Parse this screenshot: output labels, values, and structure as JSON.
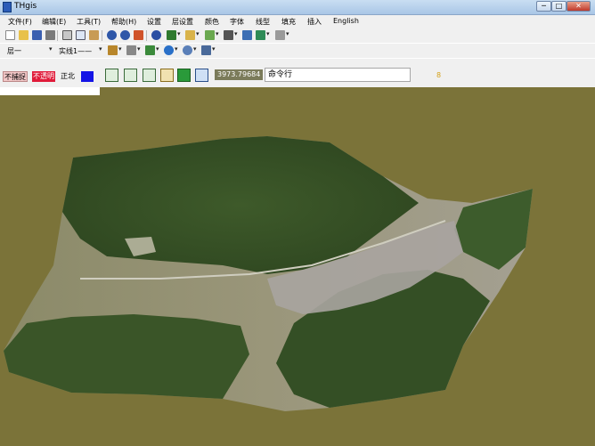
{
  "window": {
    "title": "THgis",
    "minimize": "─",
    "maximize": "□",
    "close": "✕"
  },
  "menu": [
    "文件(F)",
    "编辑(E)",
    "工具(T)",
    "帮助(H)",
    "设置",
    "层设置",
    "颜色",
    "字体",
    "线型",
    "填充",
    "插入",
    "English"
  ],
  "toolbar2": {
    "layer": "层一",
    "linetype": "实线1——"
  },
  "status": {
    "no_capture": "不捕捉",
    "transparent": "不透明",
    "north": "正北",
    "coordinate": "3973.79684",
    "command": "命令行",
    "marker": "8"
  },
  "colors": {
    "background": "#7b7339",
    "transparent_bg": "#e01b3a",
    "swatch": "#1414e6",
    "no_capture_bg": "#f2c7c7"
  },
  "icons": {
    "toolbar1": [
      "new-file-icon",
      "open-folder-icon",
      "save-icon",
      "print-icon",
      "cut-icon",
      "copy-icon",
      "paste-icon",
      "undo-icon",
      "redo-icon",
      "delete-icon",
      "help-icon",
      "layer-icon",
      "zoom-icon",
      "grid-icon",
      "axis-icon",
      "table-icon",
      "image-icon",
      "measure-icon"
    ],
    "statusrow": [
      "pan-icon",
      "zoom-window-icon",
      "heart-icon",
      "compass-icon",
      "layer-green-icon",
      "globe-icon",
      "terrain-icon"
    ]
  }
}
